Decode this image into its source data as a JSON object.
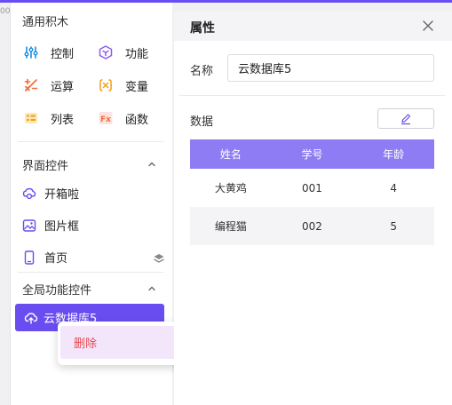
{
  "ruler_label": "00",
  "palette": {
    "common_title": "通用积木",
    "common_items": [
      {
        "label": "控制",
        "icon": "sliders-icon"
      },
      {
        "label": "功能",
        "icon": "cube-icon"
      },
      {
        "label": "运算",
        "icon": "math-ops-icon"
      },
      {
        "label": "变量",
        "icon": "variable-icon"
      },
      {
        "label": "列表",
        "icon": "list-icon"
      },
      {
        "label": "函数",
        "icon": "function-icon"
      }
    ],
    "ui_title": "界面控件",
    "ui_items": [
      {
        "label": "开箱啦",
        "icon": "cloud-loop-icon"
      },
      {
        "label": "图片框",
        "icon": "image-icon"
      },
      {
        "label": "首页",
        "icon": "phone-icon"
      }
    ],
    "global_title": "全局功能控件",
    "global_selected": {
      "label": "云数据库5",
      "icon": "cloud-upload-icon"
    }
  },
  "context_menu": {
    "delete_label": "删除"
  },
  "properties": {
    "title": "属性",
    "name_label": "名称",
    "name_value": "云数据库5",
    "data_label": "数据",
    "table": {
      "headers": [
        "姓名",
        "学号",
        "年龄"
      ],
      "rows": [
        [
          "大黄鸡",
          "001",
          "4"
        ],
        [
          "编程猫",
          "002",
          "5"
        ]
      ]
    }
  },
  "colors": {
    "accent": "#6a4df0",
    "table_header": "#8d7cf3",
    "danger": "#e5484d"
  }
}
